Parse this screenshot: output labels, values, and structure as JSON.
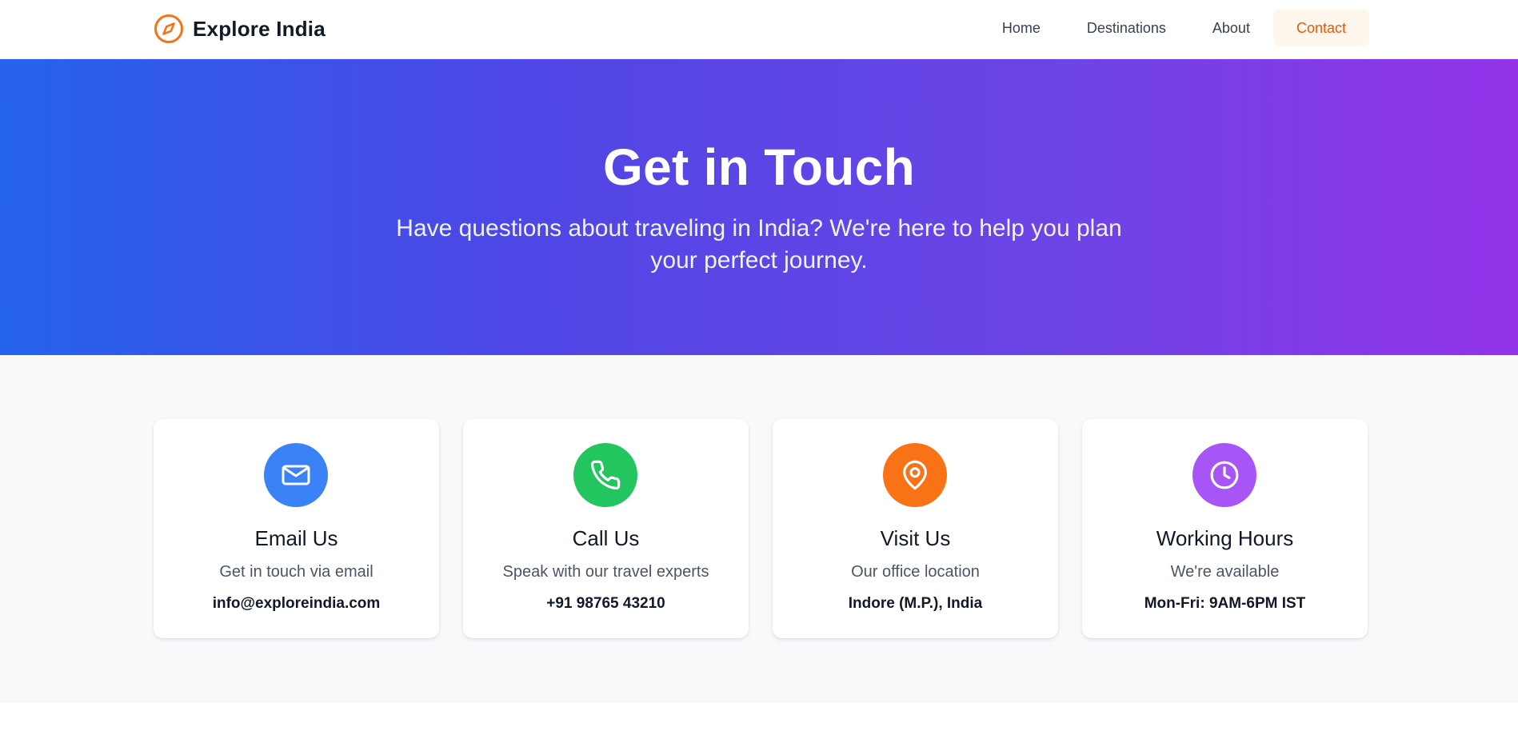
{
  "nav": {
    "brand": "Explore India",
    "links": [
      {
        "label": "Home"
      },
      {
        "label": "Destinations"
      },
      {
        "label": "About"
      },
      {
        "label": "Contact"
      }
    ],
    "active": "Contact"
  },
  "hero": {
    "title": "Get in Touch",
    "subtitle": "Have questions about traveling in India? We're here to help you plan your perfect journey."
  },
  "cards": [
    {
      "icon": "mail-icon",
      "color": "#3b82f6",
      "title": "Email Us",
      "description": "Get in touch via email",
      "value": "info@exploreindia.com"
    },
    {
      "icon": "phone-icon",
      "color": "#22c55e",
      "title": "Call Us",
      "description": "Speak with our travel experts",
      "value": "+91 98765 43210"
    },
    {
      "icon": "map-pin-icon",
      "color": "#f97316",
      "title": "Visit Us",
      "description": "Our office location",
      "value": "Indore (M.P.), India"
    },
    {
      "icon": "clock-icon",
      "color": "#a855f7",
      "title": "Working Hours",
      "description": "We're available",
      "value": "Mon-Fri: 9AM-6PM IST"
    }
  ],
  "colors": {
    "accent": "#f97316",
    "hero_gradient_start": "#2563eb",
    "hero_gradient_end": "#9333ea"
  }
}
